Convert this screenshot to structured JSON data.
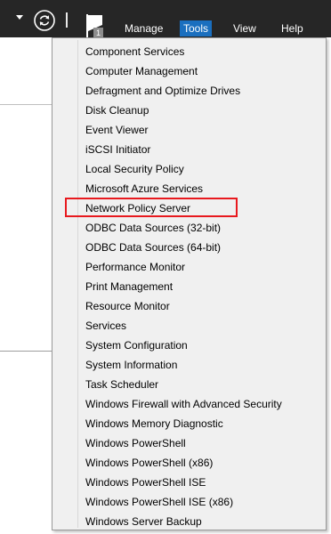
{
  "topbar": {
    "notification_count": "1",
    "menu": [
      "Manage",
      "Tools",
      "View",
      "Help"
    ],
    "active_menu": "Tools"
  },
  "tools_menu": {
    "items": [
      "Component Services",
      "Computer Management",
      "Defragment and Optimize Drives",
      "Disk Cleanup",
      "Event Viewer",
      "iSCSI Initiator",
      "Local Security Policy",
      "Microsoft Azure Services",
      "Network Policy Server",
      "ODBC Data Sources (32-bit)",
      "ODBC Data Sources (64-bit)",
      "Performance Monitor",
      "Print Management",
      "Resource Monitor",
      "Services",
      "System Configuration",
      "System Information",
      "Task Scheduler",
      "Windows Firewall with Advanced Security",
      "Windows Memory Diagnostic",
      "Windows PowerShell",
      "Windows PowerShell (x86)",
      "Windows PowerShell ISE",
      "Windows PowerShell ISE (x86)",
      "Windows Server Backup"
    ],
    "highlighted_item": "Network Policy Server"
  },
  "colors": {
    "topbar_bg": "#262626",
    "active_menu_bg": "#1a6fbf",
    "highlight_border": "#e8191e",
    "menu_bg": "#f0f0f0"
  }
}
